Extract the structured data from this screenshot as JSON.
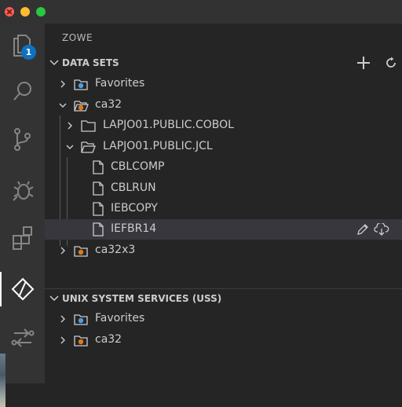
{
  "activity_bar": {
    "explorer_badge": "1",
    "items": [
      "files-icon",
      "search-icon",
      "source-control-icon",
      "debug-icon",
      "extensions-icon",
      "zowe-icon",
      "pull-requests-icon"
    ]
  },
  "sidebar": {
    "title": "ZOWE",
    "data_sets": {
      "header": "DATA SETS",
      "actions": [
        "add-icon",
        "refresh-icon"
      ],
      "tree": {
        "favorites": "Favorites",
        "profile": "ca32",
        "cobol_dataset": "LAPJO01.PUBLIC.COBOL",
        "jcl_dataset": "LAPJO01.PUBLIC.JCL",
        "members": [
          "CBLCOMP",
          "CBLRUN",
          "IEBCOPY",
          "IEFBR14"
        ],
        "profile2": "ca32x3"
      },
      "selected_actions": [
        "edit-icon",
        "download-icon"
      ]
    },
    "uss": {
      "header": "UNIX SYSTEM SERVICES (USS)",
      "tree": {
        "favorites": "Favorites",
        "profile": "ca32"
      }
    }
  },
  "colors": {
    "accent_blue": "#0e70c0",
    "profile_orange": "#e0781a",
    "favorites_blue": "#4a9ee8",
    "selection": "#37373d"
  }
}
